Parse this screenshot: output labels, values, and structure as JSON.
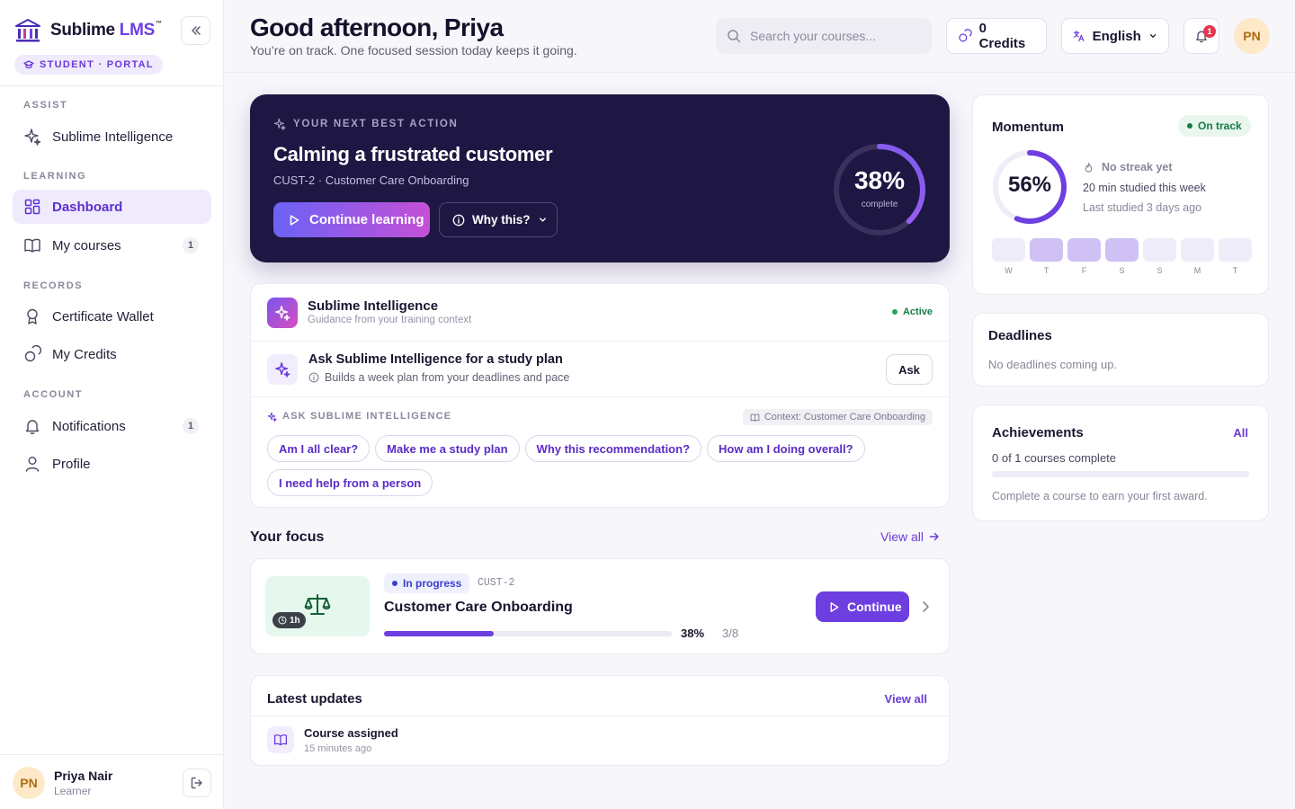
{
  "app": {
    "name_main": "Sublime ",
    "name_accent": "LMS",
    "trademark": "™",
    "portal_badge": "STUDENT · PORTAL"
  },
  "sidebar": {
    "sections": [
      {
        "label": "ASSIST"
      },
      {
        "label": "LEARNING"
      },
      {
        "label": "RECORDS"
      },
      {
        "label": "ACCOUNT"
      }
    ],
    "items": [
      {
        "label": "Sublime Intelligence",
        "icon": "sparkle-icon"
      },
      {
        "label": "Dashboard",
        "icon": "grid-icon",
        "active": true
      },
      {
        "label": "My courses",
        "icon": "book-icon",
        "count": "1"
      },
      {
        "label": "Certificate Wallet",
        "icon": "award-icon"
      },
      {
        "label": "My Credits",
        "icon": "coins-icon"
      },
      {
        "label": "Notifications",
        "icon": "bell-icon",
        "count": "1"
      },
      {
        "label": "Profile",
        "icon": "user-icon"
      }
    ],
    "user": {
      "initials": "PN",
      "name": "Priya Nair",
      "role": "Learner"
    }
  },
  "header": {
    "greeting": "Good afternoon, Priya",
    "subtitle": "You’re on track. One focused session today keeps it going.",
    "search_placeholder": "Search your courses...",
    "credits": "0 Credits",
    "language": "English",
    "notification_count": "1",
    "avatar_initials": "PN"
  },
  "hero": {
    "eyebrow": "YOUR NEXT BEST ACTION",
    "title": "Calming a frustrated customer",
    "subtitle": "CUST-2 · Customer Care Onboarding",
    "primary_button": "Continue learning",
    "secondary_button": "Why this?",
    "progress_text": "38%",
    "progress_label": "complete",
    "progress_value": 0.38
  },
  "assistant": {
    "name": "Sublime Intelligence",
    "description": "Guidance from your training context",
    "status": "Active",
    "suggestion_title": "Ask Sublime Intelligence for a study plan",
    "suggestion_sub": "Builds a week plan from your deadlines and pace",
    "ask_button": "Ask",
    "prompt_label": "ASK SUBLIME INTELLIGENCE",
    "context": "Context: Customer Care Onboarding",
    "chips": [
      "Am I all clear?",
      "Make me a study plan",
      "Why this recommendation?",
      "How am I doing overall?",
      "I need help from a person"
    ]
  },
  "focus": {
    "title": "Your focus",
    "view_all": "View all",
    "course": {
      "duration": "1h",
      "status": "In progress",
      "code": "CUST-2",
      "name": "Customer Care Onboarding",
      "progress_text": "38%",
      "progress_value": 0.38,
      "lessons": "3/8",
      "button": "Continue",
      "thumb_icon": "scales-icon"
    }
  },
  "updates": {
    "title": "Latest updates",
    "view_all": "View all",
    "items": [
      {
        "title": "Course assigned",
        "time": "15 minutes ago",
        "icon": "book-icon"
      }
    ]
  },
  "momentum": {
    "title": "Momentum",
    "status": "On track",
    "percent_text": "56%",
    "percent_value": 0.56,
    "streak": "No streak yet",
    "studied": "20 min studied this week",
    "last_studied": "Last studied 3 days ago",
    "week": [
      {
        "label": "W",
        "active": false
      },
      {
        "label": "T",
        "active": true
      },
      {
        "label": "F",
        "active": true
      },
      {
        "label": "S",
        "active": true
      },
      {
        "label": "S",
        "active": false
      },
      {
        "label": "M",
        "active": false
      },
      {
        "label": "T",
        "active": false
      }
    ]
  },
  "deadlines": {
    "title": "Deadlines",
    "empty": "No deadlines coming up."
  },
  "achievements": {
    "title": "Achievements",
    "all": "All",
    "count": "0 of 1 courses complete",
    "progress_value": 0,
    "hint": "Complete a course to earn your first award."
  },
  "colors": {
    "accent": "#6d3fe0",
    "hero_bg": "#1f1743",
    "success": "#1a7a45",
    "danger": "#e5364d"
  }
}
